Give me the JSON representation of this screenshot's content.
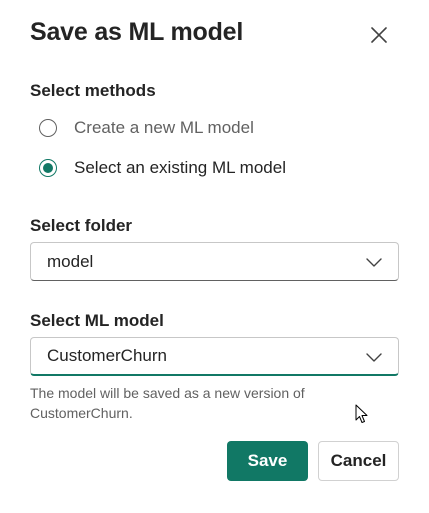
{
  "dialog": {
    "title": "Save as ML model",
    "close_icon": "close-icon"
  },
  "methods": {
    "label": "Select methods",
    "options": [
      {
        "label": "Create a new ML model",
        "selected": false
      },
      {
        "label": "Select an existing ML model",
        "selected": true
      }
    ]
  },
  "folder": {
    "label": "Select folder",
    "value": "model"
  },
  "model": {
    "label": "Select ML model",
    "value": "CustomerChurn",
    "helper": "The model will be saved as a new version of CustomerChurn."
  },
  "actions": {
    "save_label": "Save",
    "cancel_label": "Cancel"
  },
  "colors": {
    "accent": "#117865",
    "text": "#242424",
    "muted": "#616161"
  }
}
